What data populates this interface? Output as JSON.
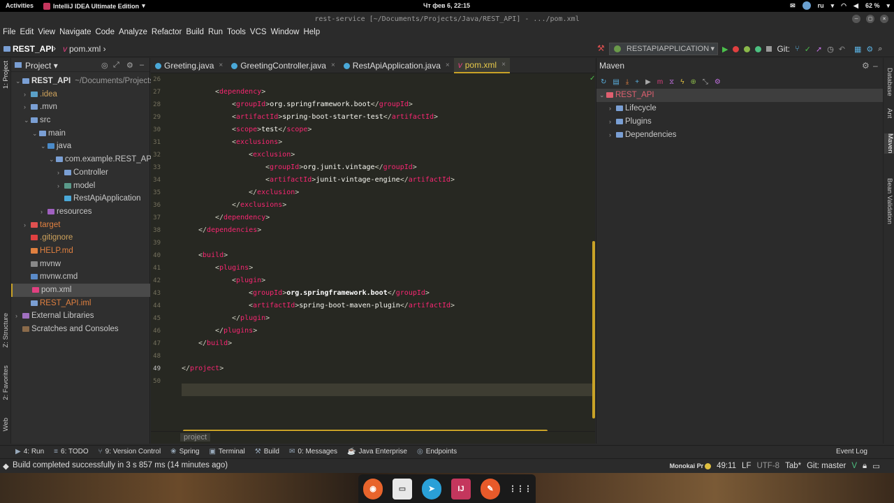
{
  "system": {
    "activities": "Activities",
    "app_name": "IntelliJ IDEA Ultimate Edition",
    "clock": "Чт фев 6, 22:15",
    "lang": "ru",
    "battery": "62 %"
  },
  "window": {
    "title": "rest-service [~/Documents/Projects/Java/REST_API] - .../pom.xml"
  },
  "menu": [
    "File",
    "Edit",
    "View",
    "Navigate",
    "Code",
    "Analyze",
    "Refactor",
    "Build",
    "Run",
    "Tools",
    "VCS",
    "Window",
    "Help"
  ],
  "nav": {
    "project": "REST_API",
    "file": "pom.xml",
    "run_config": "RESTAPIAPPLICATION",
    "git_label": "Git:"
  },
  "left_strip": {
    "project": "1: Project",
    "structure": "Z: Structure",
    "favorites": "2: Favorites",
    "web": "Web"
  },
  "right_strip": {
    "database": "Database",
    "ant": "Ant",
    "maven": "Maven",
    "bean": "Bean Validation"
  },
  "project_panel": {
    "title": "Project",
    "tree": [
      {
        "label": "REST_API",
        "extra": "~/Documents/Projects/",
        "depth": 0,
        "open": true,
        "color": "#e0e0e0",
        "icon": "#7a9fd4",
        "bold": true
      },
      {
        "label": ".idea",
        "depth": 1,
        "open": false,
        "color": "#cfa35c",
        "icon": "#5aa0c8"
      },
      {
        "label": ".mvn",
        "depth": 1,
        "open": false,
        "color": "#c8c8c8",
        "icon": "#7a9fd4"
      },
      {
        "label": "src",
        "depth": 1,
        "open": true,
        "color": "#c8c8c8",
        "icon": "#7a9fd4"
      },
      {
        "label": "main",
        "depth": 2,
        "open": true,
        "color": "#c8c8c8",
        "icon": "#7a9fd4"
      },
      {
        "label": "java",
        "depth": 3,
        "open": true,
        "color": "#c8c8c8",
        "icon": "#4a8ac8"
      },
      {
        "label": "com.example.REST_API.A",
        "depth": 4,
        "open": true,
        "color": "#c8c8c8",
        "icon": "#7a9fd4"
      },
      {
        "label": "Controller",
        "depth": 5,
        "open": false,
        "color": "#c8c8c8",
        "icon": "#7a9fd4"
      },
      {
        "label": "model",
        "depth": 5,
        "open": false,
        "color": "#c8c8c8",
        "icon": "#5a9a8a"
      },
      {
        "label": "RestApiApplication",
        "depth": 5,
        "open": null,
        "color": "#c8c8c8",
        "icon": "#4aa8d8"
      },
      {
        "label": "resources",
        "depth": 3,
        "open": false,
        "color": "#c8c8c8",
        "icon": "#a060c0"
      },
      {
        "label": "target",
        "depth": 1,
        "open": false,
        "color": "#e08040",
        "icon": "#e05050"
      },
      {
        "label": ".gitignore",
        "depth": 1,
        "open": null,
        "color": "#cfa35c",
        "icon": "#e04040"
      },
      {
        "label": "HELP.md",
        "depth": 1,
        "open": null,
        "color": "#e08040",
        "icon": "#e08040"
      },
      {
        "label": "mvnw",
        "depth": 1,
        "open": null,
        "color": "#c8c8c8",
        "icon": "#888888"
      },
      {
        "label": "mvnw.cmd",
        "depth": 1,
        "open": null,
        "color": "#c8c8c8",
        "icon": "#5a8ac8"
      },
      {
        "label": "pom.xml",
        "depth": 1,
        "open": null,
        "color": "#c8c8c8",
        "icon": "#e04080",
        "selected": true
      },
      {
        "label": "REST_API.iml",
        "depth": 1,
        "open": null,
        "color": "#e08040",
        "icon": "#7a9fd4"
      },
      {
        "label": "External Libraries",
        "depth": 0,
        "open": false,
        "color": "#c8c8c8",
        "icon": "#a070c0"
      },
      {
        "label": "Scratches and Consoles",
        "depth": 0,
        "open": null,
        "color": "#c8c8c8",
        "icon": "#8a6a4a"
      }
    ]
  },
  "tabs": [
    {
      "label": "Greeting.java",
      "icon": "#4aa8d8"
    },
    {
      "label": "GreetingController.java",
      "icon": "#4aa8d8"
    },
    {
      "label": "RestApiApplication.java",
      "icon": "#4aa8d8"
    },
    {
      "label": "pom.xml",
      "icon": "#e04080",
      "active": true
    }
  ],
  "editor": {
    "lines": [
      {
        "n": "26",
        "indent": 2,
        "parts": []
      },
      {
        "n": "27",
        "indent": 2,
        "parts": [
          [
            "br",
            "<"
          ],
          [
            "tg",
            "dependency"
          ],
          [
            "br",
            ">"
          ]
        ]
      },
      {
        "n": "28",
        "indent": 3,
        "parts": [
          [
            "br",
            "<"
          ],
          [
            "tg",
            "groupId"
          ],
          [
            "br",
            ">"
          ],
          [
            "tx",
            "org.springframework.boot"
          ],
          [
            "br",
            "</"
          ],
          [
            "tg",
            "groupId"
          ],
          [
            "br",
            ">"
          ]
        ]
      },
      {
        "n": "29",
        "indent": 3,
        "parts": [
          [
            "br",
            "<"
          ],
          [
            "tg",
            "artifactId"
          ],
          [
            "br",
            ">"
          ],
          [
            "tx",
            "spring-boot-starter-test"
          ],
          [
            "br",
            "</"
          ],
          [
            "tg",
            "artifactId"
          ],
          [
            "br",
            ">"
          ]
        ]
      },
      {
        "n": "30",
        "indent": 3,
        "parts": [
          [
            "br",
            "<"
          ],
          [
            "tg",
            "scope"
          ],
          [
            "br",
            ">"
          ],
          [
            "tx",
            "test"
          ],
          [
            "br",
            "</"
          ],
          [
            "tg",
            "scope"
          ],
          [
            "br",
            ">"
          ]
        ]
      },
      {
        "n": "31",
        "indent": 3,
        "parts": [
          [
            "br",
            "<"
          ],
          [
            "tg",
            "exclusions"
          ],
          [
            "br",
            ">"
          ]
        ]
      },
      {
        "n": "32",
        "indent": 4,
        "parts": [
          [
            "br",
            "<"
          ],
          [
            "tg",
            "exclusion"
          ],
          [
            "br",
            ">"
          ]
        ]
      },
      {
        "n": "33",
        "indent": 5,
        "parts": [
          [
            "br",
            "<"
          ],
          [
            "tg",
            "groupId"
          ],
          [
            "br",
            ">"
          ],
          [
            "tx",
            "org.junit.vintage"
          ],
          [
            "br",
            "</"
          ],
          [
            "tg",
            "groupId"
          ],
          [
            "br",
            ">"
          ]
        ]
      },
      {
        "n": "34",
        "indent": 5,
        "parts": [
          [
            "br",
            "<"
          ],
          [
            "tg",
            "artifactId"
          ],
          [
            "br",
            ">"
          ],
          [
            "tx",
            "junit-vintage-engine"
          ],
          [
            "br",
            "</"
          ],
          [
            "tg",
            "artifactId"
          ],
          [
            "br",
            ">"
          ]
        ]
      },
      {
        "n": "35",
        "indent": 4,
        "parts": [
          [
            "br",
            "</"
          ],
          [
            "tg",
            "exclusion"
          ],
          [
            "br",
            ">"
          ]
        ]
      },
      {
        "n": "36",
        "indent": 3,
        "parts": [
          [
            "br",
            "</"
          ],
          [
            "tg",
            "exclusions"
          ],
          [
            "br",
            ">"
          ]
        ]
      },
      {
        "n": "37",
        "indent": 2,
        "parts": [
          [
            "br",
            "</"
          ],
          [
            "tg",
            "dependency"
          ],
          [
            "br",
            ">"
          ]
        ]
      },
      {
        "n": "38",
        "indent": 1,
        "parts": [
          [
            "br",
            "</"
          ],
          [
            "tg",
            "dependencies"
          ],
          [
            "br",
            ">"
          ]
        ]
      },
      {
        "n": "39",
        "indent": 0,
        "parts": []
      },
      {
        "n": "40",
        "indent": 1,
        "parts": [
          [
            "br",
            "<"
          ],
          [
            "tg",
            "build"
          ],
          [
            "br",
            ">"
          ]
        ]
      },
      {
        "n": "41",
        "indent": 2,
        "parts": [
          [
            "br",
            "<"
          ],
          [
            "tg",
            "plugins"
          ],
          [
            "br",
            ">"
          ]
        ]
      },
      {
        "n": "42",
        "indent": 3,
        "parts": [
          [
            "br",
            "<"
          ],
          [
            "tg",
            "plugin"
          ],
          [
            "br",
            ">"
          ]
        ]
      },
      {
        "n": "43",
        "indent": 4,
        "parts": [
          [
            "br",
            "<"
          ],
          [
            "tg",
            "groupId"
          ],
          [
            "br",
            ">"
          ],
          [
            "tx",
            "org.springframework.boot"
          ],
          [
            "br",
            "</"
          ],
          [
            "tg",
            "groupId"
          ],
          [
            "br",
            ">"
          ]
        ]
      },
      {
        "n": "44",
        "indent": 4,
        "parts": [
          [
            "br",
            "<"
          ],
          [
            "tg",
            "artifactId"
          ],
          [
            "br",
            ">"
          ],
          [
            "tx",
            "spring-boot-maven-plugin"
          ],
          [
            "br",
            "</"
          ],
          [
            "tg",
            "artifactId"
          ],
          [
            "br",
            ">"
          ]
        ]
      },
      {
        "n": "45",
        "indent": 3,
        "parts": [
          [
            "br",
            "</"
          ],
          [
            "tg",
            "plugin"
          ],
          [
            "br",
            ">"
          ]
        ]
      },
      {
        "n": "46",
        "indent": 2,
        "parts": [
          [
            "br",
            "</"
          ],
          [
            "tg",
            "plugins"
          ],
          [
            "br",
            ">"
          ]
        ]
      },
      {
        "n": "47",
        "indent": 1,
        "parts": [
          [
            "br",
            "</"
          ],
          [
            "tg",
            "build"
          ],
          [
            "br",
            ">"
          ]
        ]
      },
      {
        "n": "48",
        "indent": 0,
        "parts": []
      },
      {
        "n": "49",
        "indent": 0,
        "parts": [
          [
            "br",
            "</"
          ],
          [
            "tg",
            "project"
          ],
          [
            "br",
            ">"
          ]
        ]
      },
      {
        "n": "50",
        "indent": 0,
        "parts": []
      }
    ],
    "breadcrumb": "project"
  },
  "maven": {
    "title": "Maven",
    "tree": [
      {
        "label": "REST_API",
        "depth": 0,
        "open": true,
        "selected": true,
        "color": "#e06070"
      },
      {
        "label": "Lifecycle",
        "depth": 1,
        "open": false,
        "color": "#c8c8c8"
      },
      {
        "label": "Plugins",
        "depth": 1,
        "open": false,
        "color": "#c8c8c8"
      },
      {
        "label": "Dependencies",
        "depth": 1,
        "open": false,
        "color": "#c8c8c8"
      }
    ]
  },
  "bottom_tabs": [
    {
      "label": "4: Run",
      "icon": "▶"
    },
    {
      "label": "6: TODO",
      "icon": "≡"
    },
    {
      "label": "9: Version Control",
      "icon": "⑂"
    },
    {
      "label": "Spring",
      "icon": "❀"
    },
    {
      "label": "Terminal",
      "icon": "▣"
    },
    {
      "label": "Build",
      "icon": "⚒"
    },
    {
      "label": "0: Messages",
      "icon": "✉"
    },
    {
      "label": "Java Enterprise",
      "icon": "☕"
    },
    {
      "label": "Endpoints",
      "icon": "◎"
    }
  ],
  "event_log": "Event Log",
  "status": {
    "message": "Build completed successfully in 3 s 857 ms (14 minutes ago)",
    "theme": "Monokai Pr",
    "position": "49:11",
    "line_sep": "LF",
    "encoding": "UTF-8",
    "indent": "Tab*",
    "git": "Git: master"
  },
  "dock": [
    {
      "name": "firefox",
      "bg": "#e8642c",
      "label": "◉"
    },
    {
      "name": "files",
      "bg": "#e8e8e8",
      "label": "▭"
    },
    {
      "name": "telegram",
      "bg": "#2aa0d8",
      "label": "➤"
    },
    {
      "name": "intellij",
      "bg": "#c4365d",
      "label": "IJ"
    },
    {
      "name": "inkscape",
      "bg": "#e85a2a",
      "label": "✎"
    },
    {
      "name": "app-grid",
      "bg": "#1a1a1a",
      "label": "⋮⋮⋮"
    }
  ]
}
